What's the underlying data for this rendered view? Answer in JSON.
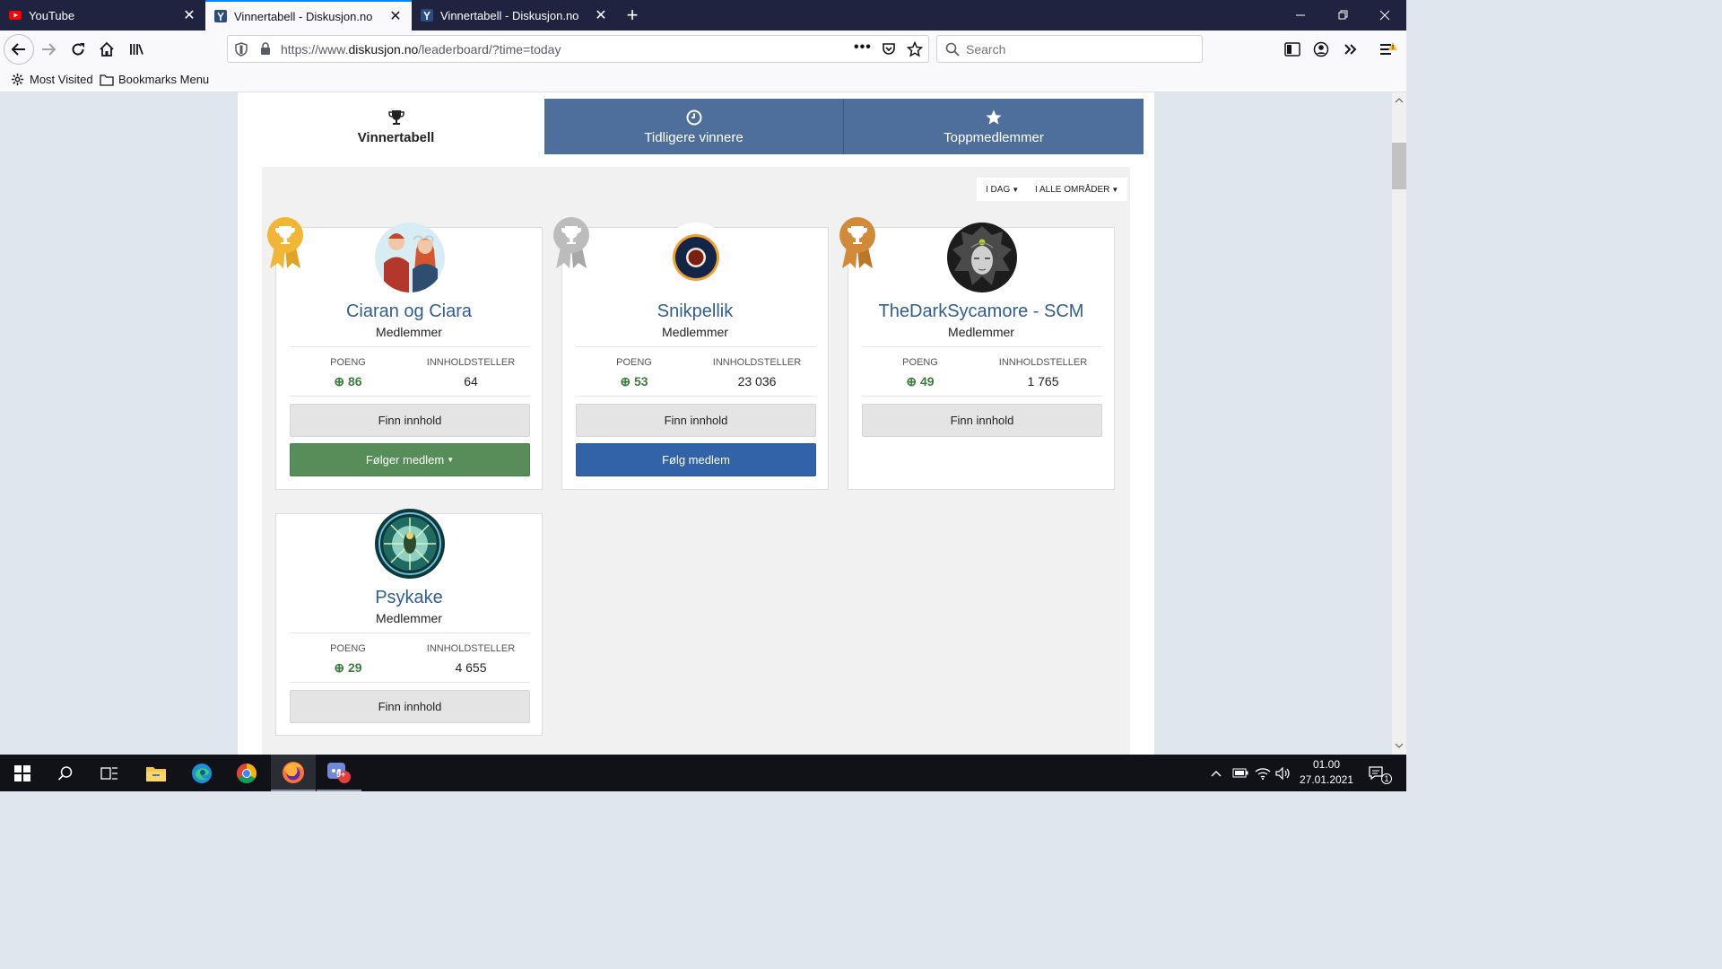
{
  "browser": {
    "tabs": [
      {
        "label": "YouTube",
        "icon": "youtube-icon"
      },
      {
        "label": "Vinnertabell - Diskusjon.no",
        "icon": "diskusjon-icon"
      },
      {
        "label": "Vinnertabell - Diskusjon.no",
        "icon": "diskusjon-icon"
      }
    ],
    "url_prefix": "https://www.",
    "url_domain": "diskusjon.no",
    "url_path": "/leaderboard/?time=today",
    "search_placeholder": "Search",
    "bookmarks": [
      {
        "label": "Most Visited",
        "icon": "gear-icon"
      },
      {
        "label": "Bookmarks Menu",
        "icon": "folder-icon"
      }
    ]
  },
  "leaderboard": {
    "tabs": [
      {
        "label": "Vinnertabell",
        "icon": "trophy-icon"
      },
      {
        "label": "Tidligere vinnere",
        "icon": "clock-icon"
      },
      {
        "label": "Toppmedlemmer",
        "icon": "star-icon"
      }
    ],
    "filters": {
      "time": "I DAG",
      "area": "I ALLE OMRÅDER"
    },
    "stat_labels": {
      "points": "POENG",
      "content": "INNHOLDSTELLER"
    },
    "find_content_label": "Finn innhold",
    "members": [
      {
        "name": "Ciaran og Ciara",
        "role": "Medlemmer",
        "points": "86",
        "content_count": "64",
        "rank": "gold",
        "follow_label": "Følger medlem",
        "follow_state": "following"
      },
      {
        "name": "Snikpellik",
        "role": "Medlemmer",
        "points": "53",
        "content_count": "23 036",
        "rank": "silver",
        "follow_label": "Følg medlem",
        "follow_state": "not-following"
      },
      {
        "name": "TheDarkSycamore - SCM",
        "role": "Medlemmer",
        "points": "49",
        "content_count": "1 765",
        "rank": "bronze"
      },
      {
        "name": "Psykake",
        "role": "Medlemmer",
        "points": "29",
        "content_count": "4 655"
      }
    ]
  },
  "taskbar": {
    "time": "01.00",
    "date": "27.01.2021",
    "notification_count": "1",
    "discord_badge": "9+"
  },
  "colors": {
    "link_blue": "#2f5d92",
    "tab_inactive": "#4e6f9c",
    "follow_green": "#568d58",
    "follow_blue": "#3262a8",
    "gold": "#f2b636",
    "silver": "#bcbcbc",
    "bronze": "#d08a3a"
  }
}
